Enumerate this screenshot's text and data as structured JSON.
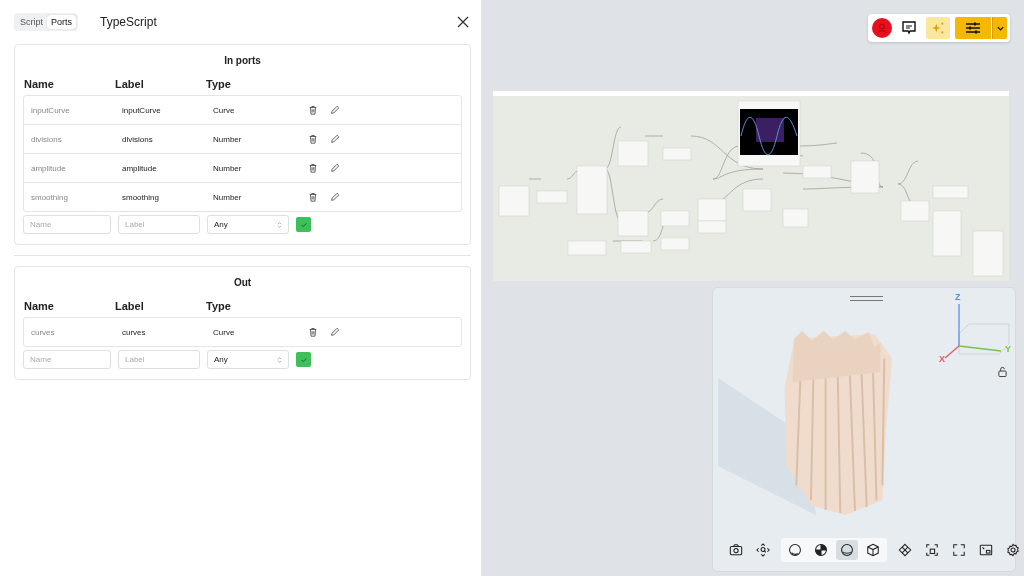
{
  "tabs": [
    {
      "label": "Script",
      "selected": false
    },
    {
      "label": "Ports",
      "selected": true
    }
  ],
  "title": "TypeScript",
  "sections": [
    {
      "title": "In ports",
      "columns": [
        "Name",
        "Label",
        "Type"
      ],
      "ports": [
        {
          "name": "inputCurve",
          "label": "inputCurve",
          "type": "Curve"
        },
        {
          "name": "divisions",
          "label": "divisions",
          "type": "Number"
        },
        {
          "name": "amplitude",
          "label": "amplitude",
          "type": "Number"
        },
        {
          "name": "smoothing",
          "label": "smoothing",
          "type": "Number"
        }
      ],
      "new_port": {
        "name_placeholder": "Name",
        "label_placeholder": "Label",
        "type": "Any"
      }
    },
    {
      "title": "Out",
      "columns": [
        "Name",
        "Label",
        "Type"
      ],
      "ports": [
        {
          "name": "curves",
          "label": "curves",
          "type": "Curve"
        }
      ],
      "new_port": {
        "name_placeholder": "Name",
        "label_placeholder": "Label",
        "type": "Any"
      }
    }
  ],
  "viewport": {
    "axes": [
      "X",
      "Y",
      "Z"
    ],
    "view_modes": [
      {
        "selected": false
      },
      {
        "selected": false
      },
      {
        "selected": true
      },
      {
        "selected": false
      }
    ]
  }
}
